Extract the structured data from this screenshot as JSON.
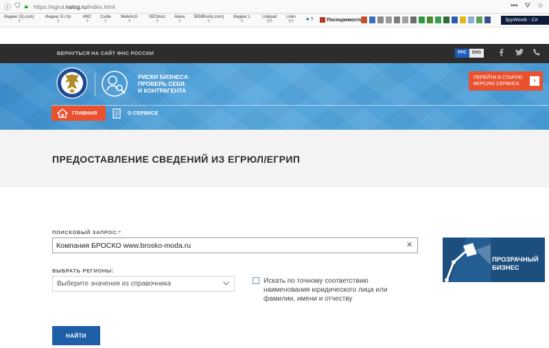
{
  "browser": {
    "url_prefix": "https://egrul.",
    "url_host": "nalog.ru",
    "url_path": "/index.html",
    "bookmarks": [
      {
        "label": "Индекс G(.com)",
        "value": "?"
      },
      {
        "label": "Индекс G стр",
        "value": "?"
      },
      {
        "label": "ИКС",
        "value": "?"
      },
      {
        "label": "Curlie",
        "value": "?"
      },
      {
        "label": "WebArch",
        "value": "?"
      },
      {
        "label": "SEOmoz",
        "value": "?"
      },
      {
        "label": "Alexa",
        "value": "?"
      },
      {
        "label": "SEMRush(.com)",
        "value": "?"
      },
      {
        "label": "Индекс L",
        "value": "?"
      },
      {
        "label": "Linkpad",
        "value": "?/?"
      },
      {
        "label": "Links",
        "value": "?/?"
      }
    ],
    "ext_count": "?",
    "visits_label": "Посещаемость",
    "spywords_label": "SpyWords - Сл"
  },
  "site": {
    "back_link": "ВЕРНУТЬСЯ НА САЙТ ФНС РОССИИ",
    "lang_ru": "РУС",
    "lang_en": "ENG",
    "tagline_1": "РИСКИ БИЗНЕСА:",
    "tagline_2": "ПРОВЕРЬ СЕБЯ",
    "tagline_3": "И КОНТРАГЕНТА",
    "old_version_1": "ПЕРЕЙТИ В СТАРУЮ",
    "old_version_2": "ВЕРСИЮ СЕРВИСА",
    "nav_home": "ГЛАВНАЯ",
    "nav_about": "О СЕРВИСЕ"
  },
  "page": {
    "title": "ПРЕДОСТАВЛЕНИЕ СВЕДЕНИЙ ИЗ ЕГРЮЛ/ЕГРИП"
  },
  "form": {
    "query_label": "ПОИСКОВЫЙ ЗАПРОС:",
    "query_required": "*",
    "query_value": "Компания БРОСКО www.brosko-moda.ru",
    "region_label": "ВЫБРАТЬ РЕГИОНЫ:",
    "region_placeholder": "Выберите значения из справочника",
    "exact_label": "Искать по точному соответствию наименования юридического лица или фамилии, имени и отчеству",
    "submit_label": "НАЙТИ"
  },
  "banner": {
    "line1": "ПРОЗРАЧНЫЙ",
    "line2": "БИЗНЕС"
  },
  "colors": {
    "accent_orange": "#e9512f",
    "primary_blue": "#1f5fa8",
    "hero_blue": "#4a9dd6",
    "top_bar": "#2d2d2d"
  }
}
